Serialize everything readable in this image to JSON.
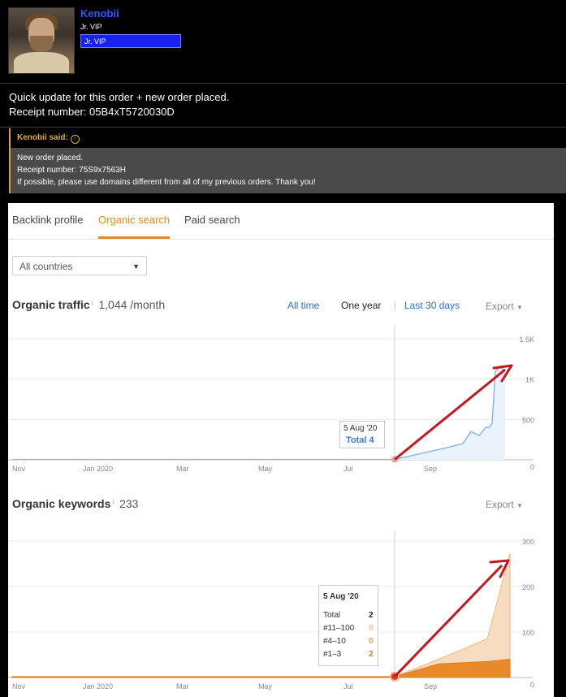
{
  "post": {
    "username": "Kenobii",
    "user_title": "Jr. VIP",
    "badge": "Jr. VIP",
    "body_line1": "Quick update for this order + new order placed.",
    "body_line2": "Receipt number: 05B4xT5720030D"
  },
  "quote": {
    "author": "Kenobii said:",
    "line1": "New order placed.",
    "line2": "Receipt number: 75S9x7563H",
    "line3": "If possible, please use domains different from all of my previous orders. Thank you!"
  },
  "tabs": [
    {
      "label": "Backlink profile",
      "active": false
    },
    {
      "label": "Organic search",
      "active": true
    },
    {
      "label": "Paid search",
      "active": false
    }
  ],
  "country_select": {
    "value": "All countries"
  },
  "traffic": {
    "title": "Organic traffic",
    "info": "i",
    "value": "1,044 /month",
    "ranges": [
      "All time",
      "One year",
      "Last 30 days"
    ],
    "active_range": "One year",
    "export_label": "Export",
    "tooltip": {
      "date": "5 Aug '20",
      "label": "Total 4"
    }
  },
  "keywords": {
    "title": "Organic keywords",
    "info": "i",
    "value": "233",
    "export_label": "Export",
    "tooltip": {
      "date": "5 Aug '20",
      "rows": [
        {
          "label": "Total",
          "value": "2"
        },
        {
          "label": "#11–100",
          "value": "0"
        },
        {
          "label": "#4–10",
          "value": "0"
        },
        {
          "label": "#1–3",
          "value": "2"
        }
      ]
    }
  },
  "colors": {
    "accent": "#e08a2a",
    "link": "#2b6fd1",
    "traffic_line": "#8bb8e6",
    "keywords_fill": "#e88a2a",
    "arrow": "#c8161e"
  },
  "chart_data": [
    {
      "type": "area",
      "title": "Organic traffic",
      "x_ticks": [
        "Nov",
        "Jan 2020",
        "Mar",
        "May",
        "Jul",
        "Sep"
      ],
      "y_ticks": [
        "0",
        "500",
        "1K",
        "1.5K"
      ],
      "ylim": [
        0,
        1500
      ],
      "x": [
        "Nov '19",
        "Aug 5 '20",
        "Aug '20",
        "Sep '20",
        "Sep '20",
        "Sep '20",
        "Oct '20",
        "Oct '20",
        "Oct '20",
        "Oct '20",
        "Oct '20",
        "Oct '20"
      ],
      "values": [
        4,
        4,
        150,
        200,
        350,
        300,
        400,
        400,
        450,
        1100,
        1150,
        1100
      ]
    },
    {
      "type": "area",
      "title": "Organic keywords",
      "x_ticks": [
        "Nov",
        "Jan 2020",
        "Mar",
        "May",
        "Jul",
        "Sep"
      ],
      "y_ticks": [
        "0",
        "100",
        "200",
        "300"
      ],
      "ylim": [
        0,
        300
      ],
      "series": [
        {
          "name": "#1–3",
          "x": [
            "Nov '19",
            "Aug 5 '20",
            "Sep '20",
            "Oct '20",
            "Oct '20"
          ],
          "values": [
            2,
            2,
            30,
            35,
            40
          ]
        },
        {
          "name": "#11–100",
          "x": [
            "Nov '19",
            "Aug 5 '20",
            "Sep '20",
            "Oct '20",
            "Oct '20"
          ],
          "values": [
            0,
            0,
            10,
            50,
            233
          ]
        }
      ]
    }
  ]
}
